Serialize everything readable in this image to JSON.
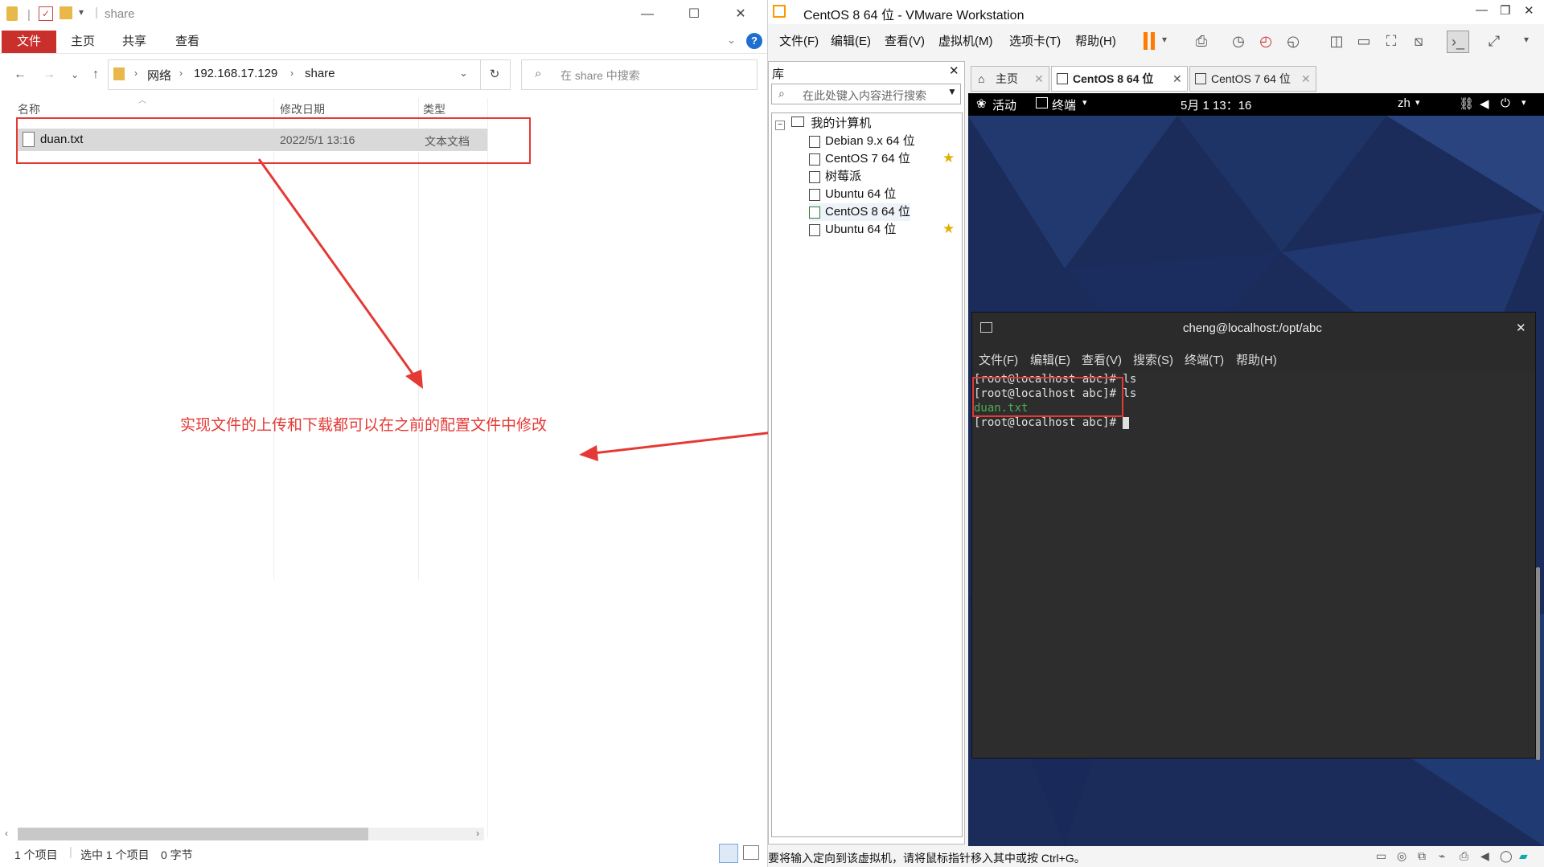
{
  "explorer": {
    "title": "share",
    "ribbon": {
      "file": "文件",
      "home": "主页",
      "share": "共享",
      "view": "查看"
    },
    "address": [
      "网络",
      "192.168.17.129",
      "share"
    ],
    "search_placeholder": "在 share 中搜索",
    "columns": {
      "name": "名称",
      "date": "修改日期",
      "type": "类型"
    },
    "files": [
      {
        "name": "duan.txt",
        "date": "2022/5/1 13:16",
        "type": "文本文档"
      }
    ],
    "status": {
      "count": "1 个项目",
      "selected": "选中 1 个项目",
      "size": "0 字节"
    },
    "window_controls": {
      "minimize": "—",
      "maximize": "☐",
      "close": "✕"
    }
  },
  "annotation": {
    "text": "实现文件的上传和下载都可以在之前的配置文件中修改",
    "color": "#e53935"
  },
  "vmware": {
    "title": "CentOS 8 64 位 - VMware Workstation",
    "menu": [
      "文件(F)",
      "编辑(E)",
      "查看(V)",
      "虚拟机(M)",
      "选项卡(T)",
      "帮助(H)"
    ],
    "library": {
      "title": "库",
      "search_placeholder": "在此处键入内容进行搜索",
      "root": "我的计算机",
      "vms": [
        {
          "name": "Debian 9.x 64 位",
          "starred": false
        },
        {
          "name": "CentOS 7 64 位",
          "starred": true
        },
        {
          "name": "树莓派",
          "starred": false
        },
        {
          "name": "Ubuntu 64 位",
          "starred": false
        },
        {
          "name": "CentOS 8 64 位",
          "starred": false,
          "running": true
        },
        {
          "name": "Ubuntu 64 位",
          "starred": true
        }
      ]
    },
    "tabs": [
      {
        "label": "主页"
      },
      {
        "label": "CentOS 8 64 位",
        "active": true
      },
      {
        "label": "CentOS 7 64 位"
      }
    ],
    "gnome": {
      "activities": "活动",
      "app": "终端",
      "clock": "5月 1  13：16",
      "lang": "zh"
    },
    "terminal": {
      "title": "cheng@localhost:/opt/abc",
      "menu": [
        "文件(F)",
        "编辑(E)",
        "查看(V)",
        "搜索(S)",
        "终端(T)",
        "帮助(H)"
      ],
      "lines": [
        {
          "text": "[root@localhost abc]# ls",
          "color": "#e0e0e0"
        },
        {
          "text": "[root@localhost abc]# ls",
          "color": "#e0e0e0"
        },
        {
          "text": "duan.txt",
          "color": "#4caf50"
        },
        {
          "text": "[root@localhost abc]# ",
          "color": "#e0e0e0",
          "cursor": true
        }
      ]
    },
    "status": "要将输入定向到该虚拟机，请将鼠标指针移入其中或按 Ctrl+G。"
  }
}
